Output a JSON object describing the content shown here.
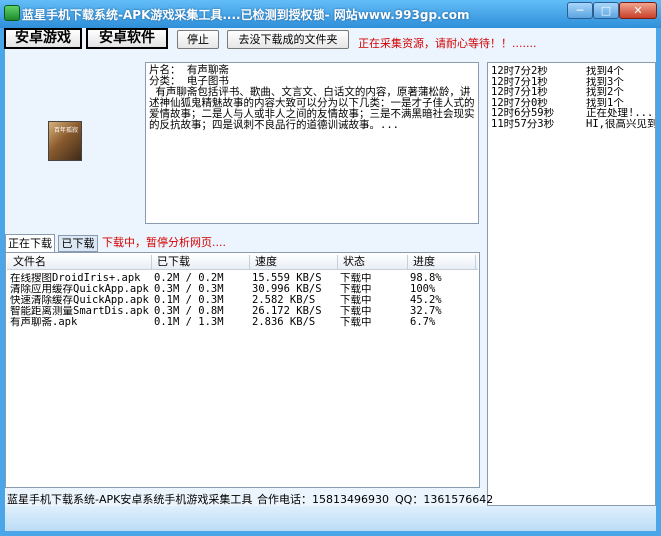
{
  "window": {
    "title": "蓝星手机下载系统-APK游戏采集工具....已检测到授权锁- 网站www.993gp.com",
    "min_glyph": "─",
    "max_glyph": "□",
    "close_glyph": "✕"
  },
  "toolbar": {
    "android_games": "安卓游戏",
    "android_apps": "安卓软件",
    "stop": "停止",
    "open_folder": "去没下载成的文件夹",
    "status": "正在采集资源，请耐心等待！！......."
  },
  "app_info": {
    "image_label": "百年孤寂",
    "lines": [
      "片名： 有声聊斋",
      "分类： 电子图书",
      " 有声聊斋包括评书、歌曲、文言文、白话文的内容，原著蒲松龄，讲述神仙狐鬼精魅故事的内容大致可以分为以下几类：一是才子佳人式的爱情故事；二是人与人或非人之间的友情故事；三是不满黑暗社会现实的反抗故事；四是讽刺不良品行的道德训诫故事。..."
    ]
  },
  "log": [
    {
      "time": "12时7分2秒",
      "msg": "找到4个"
    },
    {
      "time": "12时7分1秒",
      "msg": "找到3个"
    },
    {
      "time": "12时7分1秒",
      "msg": "找到2个"
    },
    {
      "time": "12时7分0秒",
      "msg": "找到1个"
    },
    {
      "time": "12时6分59秒",
      "msg": "正在处理!...."
    },
    {
      "time": "11时57分3秒",
      "msg": "HI,很高兴见到"
    }
  ],
  "tabs": {
    "downloading": "正在下载",
    "downloaded": "已下载",
    "status": "下载中，暂停分析网页...."
  },
  "downloads": {
    "columns": [
      "文件名",
      "已下载",
      "速度",
      "状态",
      "进度"
    ],
    "rows": [
      {
        "name": "在线搜图DroidIris+.apk",
        "downloaded": "0.2M / 0.2M",
        "speed": "15.559 KB/S",
        "status": "下载中",
        "progress": "98.8%"
      },
      {
        "name": "清除应用缓存QuickApp.apk",
        "downloaded": "0.3M / 0.3M",
        "speed": "30.996 KB/S",
        "status": "下载中",
        "progress": "100%"
      },
      {
        "name": "快速清除缓存QuickApp.apk",
        "downloaded": "0.1M / 0.3M",
        "speed": "2.582 KB/S",
        "status": "下载中",
        "progress": "45.2%"
      },
      {
        "name": "智能距离测量SmartDis.apk",
        "downloaded": "0.3M / 0.8M",
        "speed": "26.172 KB/S",
        "status": "下载中",
        "progress": "32.7%"
      },
      {
        "name": "有声聊斋.apk",
        "downloaded": "0.1M / 1.3M",
        "speed": "2.836 KB/S",
        "status": "下载中",
        "progress": "6.7%"
      }
    ]
  },
  "statusbar": {
    "company": "蓝星手机下载系统-APK安卓系统手机游戏采集工具",
    "phone": "合作电话：15813496930",
    "qq": "QQ：1361576642"
  }
}
